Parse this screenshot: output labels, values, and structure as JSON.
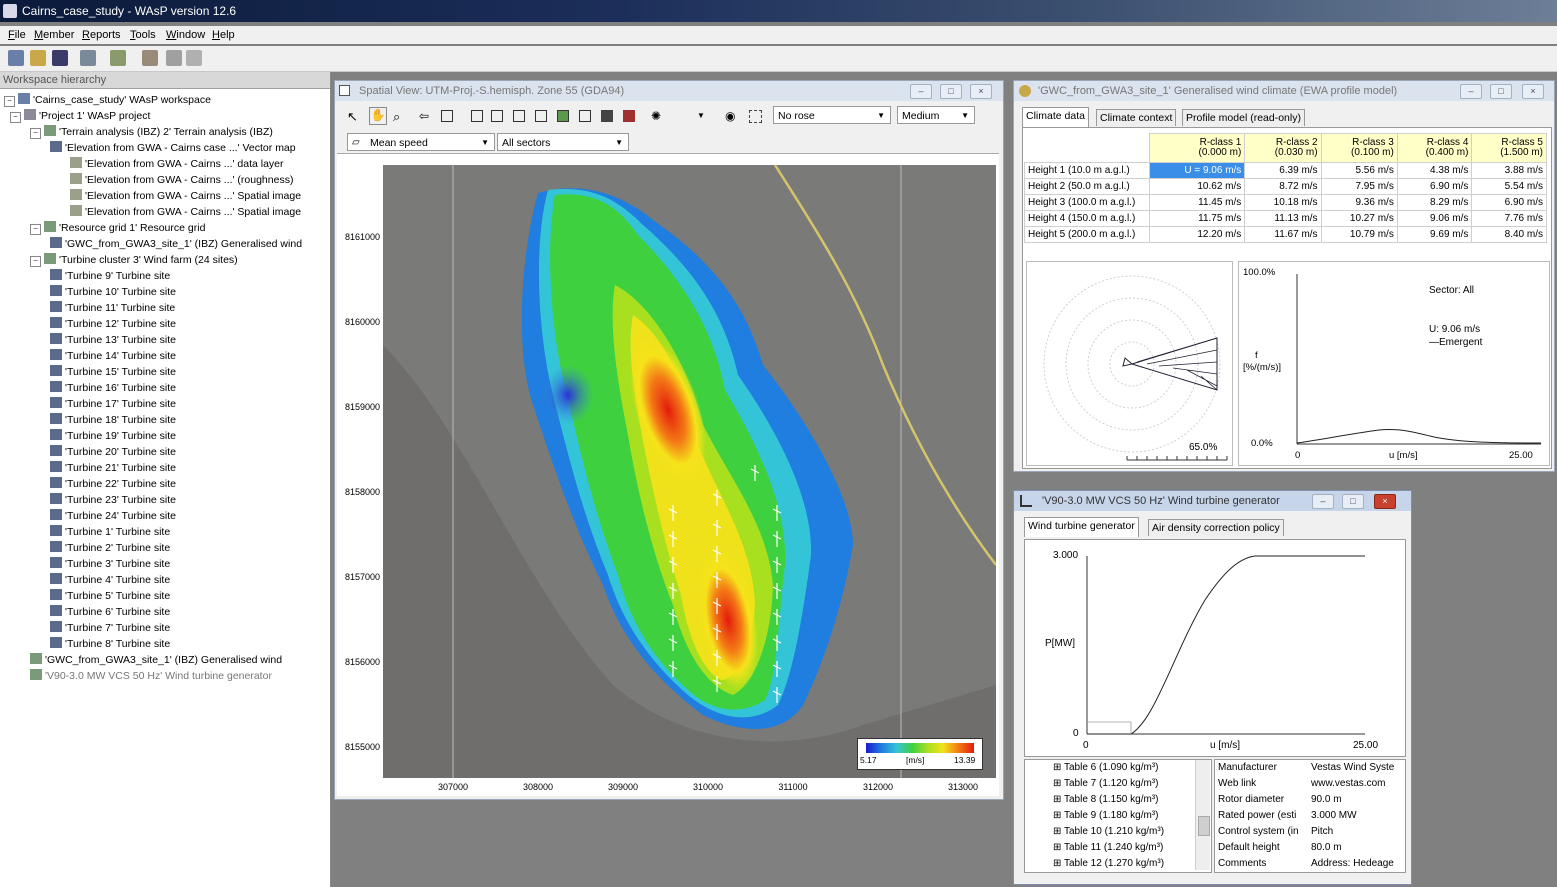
{
  "app": {
    "title": "Cairns_case_study - WAsP version 12.6",
    "menu": [
      "File",
      "Member",
      "Reports",
      "Tools",
      "Window",
      "Help"
    ]
  },
  "workspace": {
    "header": "Workspace hierarchy",
    "items": [
      {
        "label": "'Cairns_case_study' WAsP workspace",
        "level": 0
      },
      {
        "label": "'Project 1' WAsP project",
        "level": 1
      },
      {
        "label": "'Terrain analysis (IBZ) 2' Terrain analysis (IBZ)",
        "level": 2
      },
      {
        "label": "'Elevation from GWA - Cairns case ...' Vector map",
        "level": 3
      },
      {
        "label": "'Elevation from GWA - Cairns ...' data layer",
        "level": 4
      },
      {
        "label": "'Elevation from GWA - Cairns ...' (roughness)",
        "level": 4
      },
      {
        "label": "'Elevation from GWA - Cairns ...' Spatial image",
        "level": 4
      },
      {
        "label": "'Elevation from GWA - Cairns ...' Spatial image",
        "level": 4
      },
      {
        "label": "'Resource grid 1' Resource grid",
        "level": 2
      },
      {
        "label": "'GWC_from_GWA3_site_1' (IBZ) Generalised wind",
        "level": 3
      },
      {
        "label": "'Turbine cluster 3' Wind farm (24 sites)",
        "level": 2
      },
      {
        "label": "'Turbine 9' Turbine site",
        "level": 3
      },
      {
        "label": "'Turbine 10' Turbine site",
        "level": 3
      },
      {
        "label": "'Turbine 11' Turbine site",
        "level": 3
      },
      {
        "label": "'Turbine 12' Turbine site",
        "level": 3
      },
      {
        "label": "'Turbine 13' Turbine site",
        "level": 3
      },
      {
        "label": "'Turbine 14' Turbine site",
        "level": 3
      },
      {
        "label": "'Turbine 15' Turbine site",
        "level": 3
      },
      {
        "label": "'Turbine 16' Turbine site",
        "level": 3
      },
      {
        "label": "'Turbine 17' Turbine site",
        "level": 3
      },
      {
        "label": "'Turbine 18' Turbine site",
        "level": 3
      },
      {
        "label": "'Turbine 19' Turbine site",
        "level": 3
      },
      {
        "label": "'Turbine 20' Turbine site",
        "level": 3
      },
      {
        "label": "'Turbine 21' Turbine site",
        "level": 3
      },
      {
        "label": "'Turbine 22' Turbine site",
        "level": 3
      },
      {
        "label": "'Turbine 23' Turbine site",
        "level": 3
      },
      {
        "label": "'Turbine 24' Turbine site",
        "level": 3
      },
      {
        "label": "'Turbine 1' Turbine site",
        "level": 3
      },
      {
        "label": "'Turbine 2' Turbine site",
        "level": 3
      },
      {
        "label": "'Turbine 3' Turbine site",
        "level": 3
      },
      {
        "label": "'Turbine 4' Turbine site",
        "level": 3
      },
      {
        "label": "'Turbine 5' Turbine site",
        "level": 3
      },
      {
        "label": "'Turbine 6' Turbine site",
        "level": 3
      },
      {
        "label": "'Turbine 7' Turbine site",
        "level": 3
      },
      {
        "label": "'Turbine 8' Turbine site",
        "level": 3
      },
      {
        "label": "'GWC_from_GWA3_site_1' (IBZ) Generalised wind",
        "level": 2
      },
      {
        "label": "'V90-3.0 MW VCS 50 Hz' Wind turbine generator",
        "level": 2
      }
    ]
  },
  "spatial_view": {
    "title": "Spatial View: UTM-Proj.-S.hemisph. Zone 55 (GDA94)",
    "rose_select": "No rose",
    "size_select": "Medium",
    "variable_select": "Mean speed",
    "sector_select": "All sectors",
    "y_ticks": [
      "8161000",
      "8160000",
      "8159000",
      "8158000",
      "8157000",
      "8156000",
      "8155000"
    ],
    "x_ticks": [
      "307000",
      "308000",
      "309000",
      "310000",
      "311000",
      "312000",
      "313000"
    ],
    "legend_min": "5.17",
    "legend_unit": "[m/s]",
    "legend_max": "13.39"
  },
  "gwc": {
    "title": "'GWC_from_GWA3_site_1' Generalised wind climate (EWA profile model)",
    "tabs": [
      "Climate data",
      "Climate context",
      "Profile model (read-only)"
    ],
    "columns": [
      {
        "name": "R-class 1",
        "sub": "(0.000 m)"
      },
      {
        "name": "R-class 2",
        "sub": "(0.030 m)"
      },
      {
        "name": "R-class 3",
        "sub": "(0.100 m)"
      },
      {
        "name": "R-class 4",
        "sub": "(0.400 m)"
      },
      {
        "name": "R-class 5",
        "sub": "(1.500 m)"
      }
    ],
    "rows": [
      {
        "label": "Height 1  (10.0 m a.g.l.)",
        "values": [
          "U = 9.06 m/s",
          "6.39 m/s",
          "5.56 m/s",
          "4.38 m/s",
          "3.88 m/s"
        ]
      },
      {
        "label": "Height 2  (50.0 m a.g.l.)",
        "values": [
          "10.62 m/s",
          "8.72 m/s",
          "7.95 m/s",
          "6.90 m/s",
          "5.54 m/s"
        ]
      },
      {
        "label": "Height 3  (100.0 m a.g.l.)",
        "values": [
          "11.45 m/s",
          "10.18 m/s",
          "9.36 m/s",
          "8.29 m/s",
          "6.90 m/s"
        ]
      },
      {
        "label": "Height 4  (150.0 m a.g.l.)",
        "values": [
          "11.75 m/s",
          "11.13 m/s",
          "10.27 m/s",
          "9.06 m/s",
          "7.76 m/s"
        ]
      },
      {
        "label": "Height 5  (200.0 m a.g.l.)",
        "values": [
          "12.20 m/s",
          "11.67 m/s",
          "10.79 m/s",
          "9.69 m/s",
          "8.40 m/s"
        ]
      }
    ],
    "rose_pct": "65.0%",
    "dist_ymax": "100.0%",
    "dist_ymin": "0.0%",
    "dist_ylabel_1": "f",
    "dist_ylabel_2": "[%/(m/s)]",
    "dist_xmin": "0",
    "dist_xlabel": "u [m/s]",
    "dist_xmax": "25.00",
    "sector": "Sector: All",
    "u_text": "U: 9.06 m/s",
    "emergent": "Emergent"
  },
  "wtg": {
    "title": "'V90-3.0 MW VCS 50 Hz' Wind turbine generator",
    "tabs": [
      "Wind turbine generator",
      "Air density correction policy"
    ],
    "y_top": "3.000",
    "y_bottom": "0",
    "ylabel": "P[MW]",
    "x_min": "0",
    "xlabel": "u [m/s]",
    "x_max": "25.00",
    "tables": [
      "Table 6 (1.090 kg/m³)",
      "Table 7 (1.120 kg/m³)",
      "Table 8 (1.150 kg/m³)",
      "Table 9 (1.180 kg/m³)",
      "Table 10 (1.210 kg/m³)",
      "Table 11 (1.240 kg/m³)",
      "Table 12 (1.270 kg/m³)"
    ],
    "props": [
      {
        "k": "Manufacturer",
        "v": "Vestas Wind Syste"
      },
      {
        "k": "Web link",
        "v": "www.vestas.com"
      },
      {
        "k": "Rotor diameter",
        "v": "90.0 m"
      },
      {
        "k": "Rated power (esti",
        "v": "3.000 MW"
      },
      {
        "k": "Control system (in",
        "v": "Pitch"
      },
      {
        "k": "Default height",
        "v": "80.0 m"
      },
      {
        "k": "Comments",
        "v": "Address: Hedeage"
      }
    ]
  }
}
